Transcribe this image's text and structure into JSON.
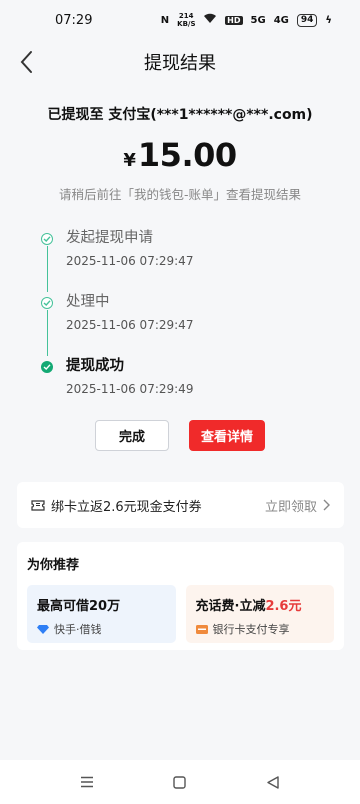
{
  "status_bar": {
    "time": "07:29",
    "net_speed": "214 KB/S",
    "signal_labels": [
      "5G",
      "4G"
    ],
    "battery": "94"
  },
  "header": {
    "title": "提现结果"
  },
  "withdraw": {
    "target_text": "已提现至 支付宝(***1******@***.com)",
    "currency": "¥",
    "amount": "15.00",
    "hint": "请稍后前往「我的钱包-账单」查看提现结果"
  },
  "timeline": [
    {
      "title": "发起提现申请",
      "time": "2025-11-06 07:29:47"
    },
    {
      "title": "处理中",
      "time": "2025-11-06 07:29:47"
    },
    {
      "title": "提现成功",
      "time": "2025-11-06 07:29:49"
    }
  ],
  "buttons": {
    "done": "完成",
    "details": "查看详情"
  },
  "coupon": {
    "text": "绑卡立返2.6元现金支付券",
    "action": "立即领取"
  },
  "recommend": {
    "title": "为你推荐",
    "cards": [
      {
        "main": "最高可借20万",
        "main_highlight": "",
        "sub": "快手·借钱"
      },
      {
        "main": "充话费·立减",
        "main_highlight": "2.6元",
        "sub": "银行卡支付专享"
      }
    ]
  },
  "colors": {
    "accent_red": "#f02a2a",
    "success_green": "#13a974"
  }
}
